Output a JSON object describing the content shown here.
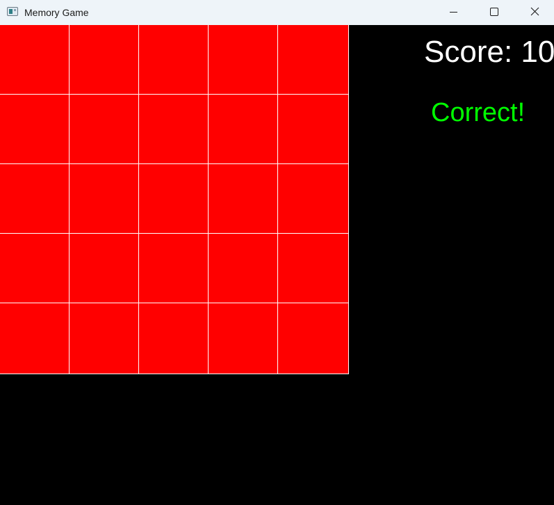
{
  "window": {
    "title": "Memory Game",
    "icon": "app-window-icon",
    "controls": {
      "minimize_icon": "minimize-icon",
      "maximize_icon": "maximize-icon",
      "close_icon": "close-icon"
    }
  },
  "board": {
    "rows": 5,
    "cols": 5,
    "tile_color": "#ff0000",
    "grid_line_color": "#ffffff",
    "face_down_tiles": 25
  },
  "hud": {
    "score_text": "Score: 10",
    "status_text": "Correct!",
    "score_color": "#ffffff",
    "status_color": "#00ff00"
  },
  "background_color": "#000000"
}
